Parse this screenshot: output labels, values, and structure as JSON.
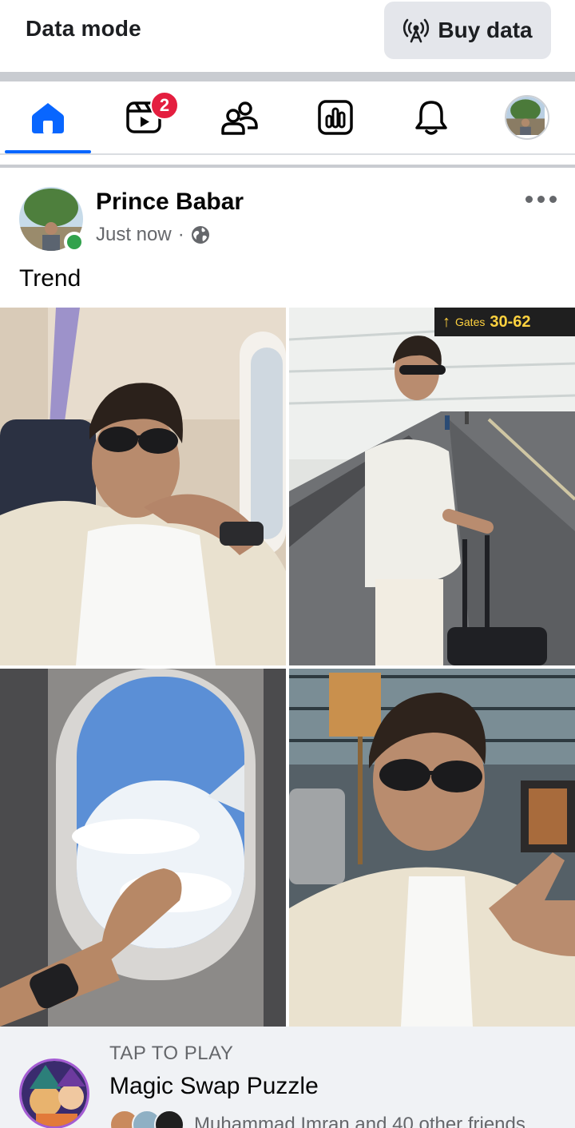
{
  "databar": {
    "title": "Data mode",
    "buy_label": "Buy data"
  },
  "nav": {
    "items": [
      {
        "name": "home",
        "active": true
      },
      {
        "name": "video",
        "badge": "2"
      },
      {
        "name": "friends"
      },
      {
        "name": "dashboard"
      },
      {
        "name": "notifications"
      },
      {
        "name": "profile"
      }
    ]
  },
  "post": {
    "author": "Prince Babar",
    "time": "Just now",
    "separator": "·",
    "privacy": "public",
    "text": "Trend",
    "photos": [
      {
        "description": "selfie in airplane seat"
      },
      {
        "description": "airport walkway with suitcase",
        "sign_arrow": "↑",
        "sign_label": "Gates",
        "sign_numbers": "30-62"
      },
      {
        "description": "airplane window with clouds"
      },
      {
        "description": "selfie in airport lounge"
      }
    ]
  },
  "game": {
    "tap_label": "TAP TO PLAY",
    "title": "Magic Swap Puzzle",
    "friends_text": "Muhammad  Imran and 40 other friends"
  },
  "colors": {
    "accent": "#0866ff",
    "badge": "#e41e3f",
    "online": "#31a24c",
    "separator": "#c9ccd1",
    "card_bg": "#f0f2f5"
  }
}
